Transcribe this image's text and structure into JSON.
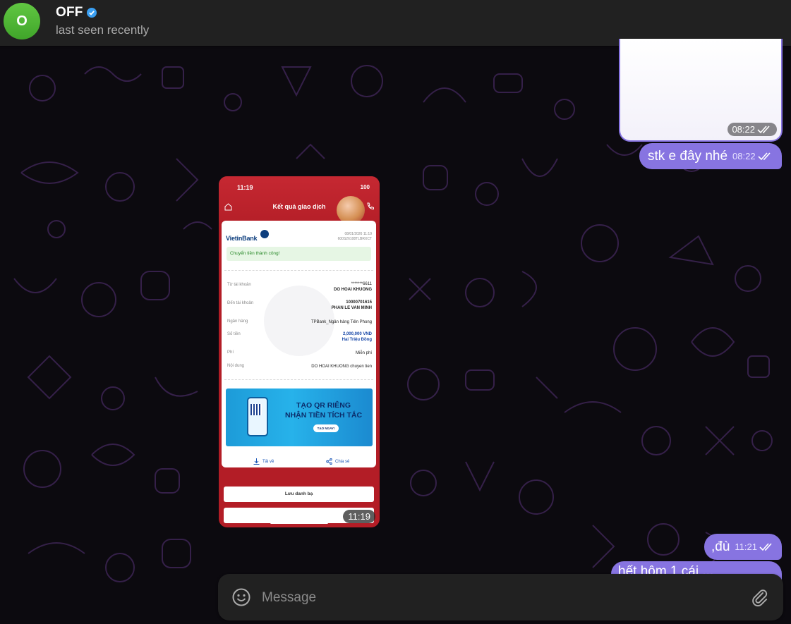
{
  "header": {
    "avatar_initial": "O",
    "title": "OFF",
    "status": "last seen recently"
  },
  "messages": {
    "image_top_time": "08:22",
    "msg1_text": "stk e đây nhé",
    "msg1_time": "08:22",
    "phone_screenshot_time": "11:19",
    "msg2_text": ",đù",
    "msg2_time": "11:21",
    "msg3_partial_text": "hết hôm 1 cái ..."
  },
  "phone_screenshot": {
    "clock": "11:19",
    "battery": "100",
    "title": "Kết quả giao dịch",
    "bank_name": "VietinBank",
    "date": "08/01/2026 11:19",
    "ref": "600S26108TLBRXCT",
    "success_text": "Chuyển tiền thành công!",
    "rows": [
      {
        "label": "Từ tài khoản",
        "value1": "*******6611",
        "value2": "DO HOAI KHUONG"
      },
      {
        "label": "Đến tài khoản",
        "value1": "10000701615",
        "value2": "PHAN LE VAN MINH"
      },
      {
        "label": "Ngân hàng",
        "value1": "TPBank_Ngân hàng Tiên Phong"
      },
      {
        "label": "Số tiền",
        "value1": "2,000,000 VND",
        "value2": "Hai Triệu Đồng"
      },
      {
        "label": "Phí",
        "value1": "Miễn phí"
      },
      {
        "label": "Nội dung",
        "value1": "DO HOAI KHUONG chuyen tien"
      }
    ],
    "banner_line1": "TẠO QR RIÊNG",
    "banner_line2": "NHẬN TIỀN TÍCH TẮC",
    "banner_button": "TẠO NGAY!",
    "download_label": "Tải về",
    "share_label": "Chia sẻ",
    "save_contact_label": "Lưu danh bạ"
  },
  "composer": {
    "placeholder": "Message"
  },
  "colors": {
    "accent": "#8774e1",
    "header_bg": "#212121",
    "avatar": "#4fb636",
    "verified": "#3a9ff2",
    "bank_red": "#b31d26"
  }
}
